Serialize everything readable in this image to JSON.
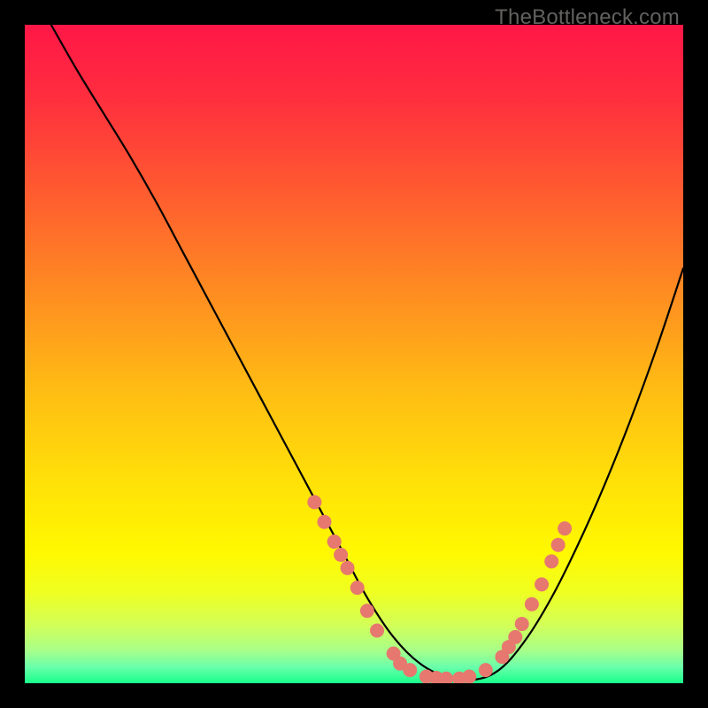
{
  "watermark": "TheBottleneck.com",
  "gradient": {
    "stops": [
      {
        "offset": 0.0,
        "color": "#ff1747"
      },
      {
        "offset": 0.1,
        "color": "#ff2b3f"
      },
      {
        "offset": 0.25,
        "color": "#ff5a30"
      },
      {
        "offset": 0.4,
        "color": "#ff8a22"
      },
      {
        "offset": 0.55,
        "color": "#ffbb14"
      },
      {
        "offset": 0.7,
        "color": "#ffe208"
      },
      {
        "offset": 0.8,
        "color": "#fff800"
      },
      {
        "offset": 0.86,
        "color": "#f0ff20"
      },
      {
        "offset": 0.91,
        "color": "#d4ff56"
      },
      {
        "offset": 0.95,
        "color": "#a8ff88"
      },
      {
        "offset": 0.975,
        "color": "#6bffab"
      },
      {
        "offset": 1.0,
        "color": "#18ff8b"
      }
    ]
  },
  "chart_data": {
    "type": "line",
    "title": "",
    "xlabel": "",
    "ylabel": "",
    "xlim": [
      0,
      100
    ],
    "ylim": [
      0,
      100
    ],
    "series": [
      {
        "name": "bottleneck-curve",
        "x": [
          4,
          8,
          12,
          16,
          20,
          24,
          28,
          32,
          36,
          40,
          44,
          48,
          52,
          56,
          60,
          64,
          68,
          72,
          76,
          80,
          84,
          88,
          92,
          96,
          100
        ],
        "y": [
          100,
          93,
          86.5,
          80,
          73,
          65.5,
          58,
          50.5,
          43,
          35.5,
          28,
          20.5,
          13,
          7,
          3,
          1,
          0.5,
          2,
          6.5,
          13,
          21,
          30,
          40,
          51,
          63
        ]
      }
    ],
    "scatter": {
      "name": "sample-points",
      "color": "#e6786f",
      "radius_px": 8,
      "points": [
        {
          "x": 44.0,
          "y": 27.5
        },
        {
          "x": 45.5,
          "y": 24.5
        },
        {
          "x": 47.0,
          "y": 21.5
        },
        {
          "x": 48.0,
          "y": 19.5
        },
        {
          "x": 49.0,
          "y": 17.5
        },
        {
          "x": 50.5,
          "y": 14.5
        },
        {
          "x": 52.0,
          "y": 11.0
        },
        {
          "x": 53.5,
          "y": 8.0
        },
        {
          "x": 56.0,
          "y": 4.5
        },
        {
          "x": 57.0,
          "y": 3.0
        },
        {
          "x": 58.5,
          "y": 2.0
        },
        {
          "x": 61.0,
          "y": 1.0
        },
        {
          "x": 62.5,
          "y": 0.8
        },
        {
          "x": 64.0,
          "y": 0.7
        },
        {
          "x": 66.0,
          "y": 0.7
        },
        {
          "x": 67.5,
          "y": 1.0
        },
        {
          "x": 70.0,
          "y": 2.0
        },
        {
          "x": 72.5,
          "y": 4.0
        },
        {
          "x": 73.5,
          "y": 5.5
        },
        {
          "x": 74.5,
          "y": 7.0
        },
        {
          "x": 75.5,
          "y": 9.0
        },
        {
          "x": 77.0,
          "y": 12.0
        },
        {
          "x": 78.5,
          "y": 15.0
        },
        {
          "x": 80.0,
          "y": 18.5
        },
        {
          "x": 81.0,
          "y": 21.0
        },
        {
          "x": 82.0,
          "y": 23.5
        }
      ]
    }
  }
}
